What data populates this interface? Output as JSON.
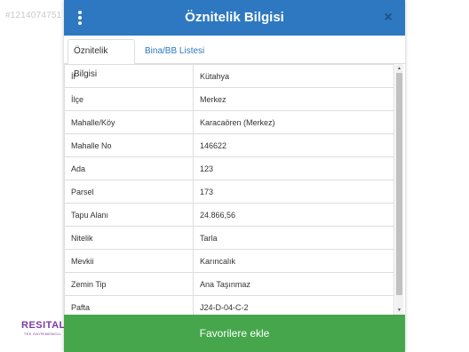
{
  "listing_id": "#1214074751",
  "brand": {
    "name": "RESITAL",
    "sub": "TEK GAYRİMENKUL"
  },
  "modal": {
    "title": "Öznitelik Bilgisi",
    "close": "×",
    "tabs": [
      {
        "label": "Öznitelik Bilgisi",
        "active": true
      },
      {
        "label": "Bina/BB Listesi",
        "active": false
      }
    ],
    "rows": [
      {
        "key": "İl",
        "value": "Kütahya"
      },
      {
        "key": "İlçe",
        "value": "Merkez"
      },
      {
        "key": "Mahalle/Köy",
        "value": "Karacaören (Merkez)"
      },
      {
        "key": "Mahalle No",
        "value": "146622"
      },
      {
        "key": "Ada",
        "value": "123"
      },
      {
        "key": "Parsel",
        "value": "173"
      },
      {
        "key": "Tapu Alanı",
        "value": "24.866,56"
      },
      {
        "key": "Nitelik",
        "value": "Tarla"
      },
      {
        "key": "Mevkii",
        "value": "Karıncalık"
      },
      {
        "key": "Zemin Tip",
        "value": "Ana Taşınmaz"
      },
      {
        "key": "Pafta",
        "value": "J24-D-04-C-2"
      }
    ],
    "scroll": {
      "up": "▲",
      "down": "▼"
    },
    "favorite_button": "Favorilere ekle"
  },
  "colors": {
    "header": "#2d78c0",
    "button": "#45a64b",
    "tab_link": "#2d78c0",
    "brand": "#7b3aa6"
  }
}
